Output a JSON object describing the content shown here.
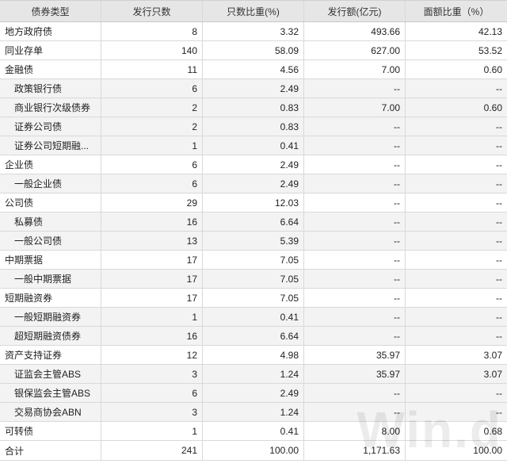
{
  "header": [
    "债券类型",
    "发行只数",
    "只数比重(%)",
    "发行额(亿元)",
    "面额比重（%）"
  ],
  "rows": [
    {
      "level": "top",
      "cells": [
        "地方政府债",
        "8",
        "3.32",
        "493.66",
        "42.13"
      ]
    },
    {
      "level": "top",
      "cells": [
        "同业存单",
        "140",
        "58.09",
        "627.00",
        "53.52"
      ]
    },
    {
      "level": "top",
      "cells": [
        "金融债",
        "11",
        "4.56",
        "7.00",
        "0.60"
      ]
    },
    {
      "level": "sub",
      "cells": [
        "政策银行债",
        "6",
        "2.49",
        "--",
        "--"
      ]
    },
    {
      "level": "sub",
      "cells": [
        "商业银行次级债券",
        "2",
        "0.83",
        "7.00",
        "0.60"
      ]
    },
    {
      "level": "sub",
      "cells": [
        "证券公司债",
        "2",
        "0.83",
        "--",
        "--"
      ]
    },
    {
      "level": "sub",
      "cells": [
        "证券公司短期融...",
        "1",
        "0.41",
        "--",
        "--"
      ]
    },
    {
      "level": "top",
      "cells": [
        "企业债",
        "6",
        "2.49",
        "--",
        "--"
      ]
    },
    {
      "level": "sub",
      "cells": [
        "一般企业债",
        "6",
        "2.49",
        "--",
        "--"
      ]
    },
    {
      "level": "top",
      "cells": [
        "公司债",
        "29",
        "12.03",
        "--",
        "--"
      ]
    },
    {
      "level": "sub",
      "cells": [
        "私募债",
        "16",
        "6.64",
        "--",
        "--"
      ]
    },
    {
      "level": "sub",
      "cells": [
        "一般公司债",
        "13",
        "5.39",
        "--",
        "--"
      ]
    },
    {
      "level": "top",
      "cells": [
        "中期票据",
        "17",
        "7.05",
        "--",
        "--"
      ]
    },
    {
      "level": "sub",
      "cells": [
        "一般中期票据",
        "17",
        "7.05",
        "--",
        "--"
      ]
    },
    {
      "level": "top",
      "cells": [
        "短期融资券",
        "17",
        "7.05",
        "--",
        "--"
      ]
    },
    {
      "level": "sub",
      "cells": [
        "一般短期融资券",
        "1",
        "0.41",
        "--",
        "--"
      ]
    },
    {
      "level": "sub",
      "cells": [
        "超短期融资债券",
        "16",
        "6.64",
        "--",
        "--"
      ]
    },
    {
      "level": "top",
      "cells": [
        "资产支持证券",
        "12",
        "4.98",
        "35.97",
        "3.07"
      ]
    },
    {
      "level": "sub",
      "cells": [
        "证监会主管ABS",
        "3",
        "1.24",
        "35.97",
        "3.07"
      ]
    },
    {
      "level": "sub",
      "cells": [
        "银保监会主管ABS",
        "6",
        "2.49",
        "--",
        "--"
      ]
    },
    {
      "level": "sub",
      "cells": [
        "交易商协会ABN",
        "3",
        "1.24",
        "--",
        "--"
      ]
    },
    {
      "level": "top",
      "cells": [
        "可转债",
        "1",
        "0.41",
        "8.00",
        "0.68"
      ]
    }
  ],
  "total": [
    "合计",
    "241",
    "100.00",
    "1,171.63",
    "100.00"
  ],
  "watermark": "Win.d"
}
